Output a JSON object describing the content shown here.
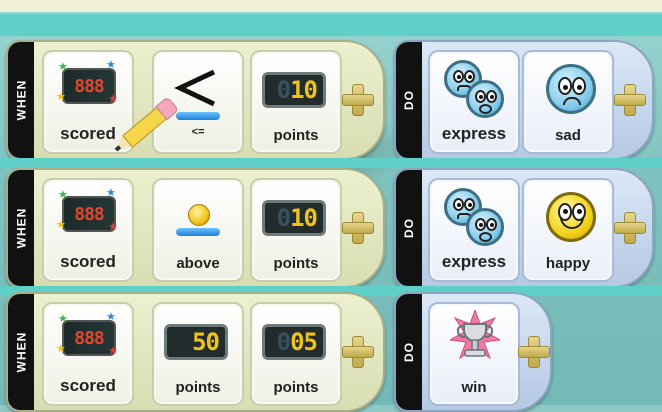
{
  "rules": [
    {
      "when_tab": "WHEN",
      "do_tab": "DO",
      "when_tiles": [
        {
          "kind": "score",
          "label": "scored",
          "digits": "888"
        },
        {
          "kind": "comparator",
          "symbol": "≤",
          "label": "<="
        },
        {
          "kind": "number",
          "label": "points",
          "dim": "0",
          "value": "10"
        }
      ],
      "do_tiles": [
        {
          "kind": "express",
          "label": "express"
        },
        {
          "kind": "face",
          "mood": "sad",
          "label": "sad"
        }
      ]
    },
    {
      "when_tab": "WHEN",
      "do_tab": "DO",
      "when_tiles": [
        {
          "kind": "score",
          "label": "scored",
          "digits": "888"
        },
        {
          "kind": "above",
          "label": "above"
        },
        {
          "kind": "number",
          "label": "points",
          "dim": "0",
          "value": "10"
        }
      ],
      "do_tiles": [
        {
          "kind": "express",
          "label": "express"
        },
        {
          "kind": "face",
          "mood": "happy",
          "label": "happy"
        }
      ]
    },
    {
      "when_tab": "WHEN",
      "do_tab": "DO",
      "when_tiles": [
        {
          "kind": "score",
          "label": "scored",
          "digits": "888"
        },
        {
          "kind": "number",
          "label": "points",
          "dim": "",
          "value": "50"
        },
        {
          "kind": "number",
          "label": "points",
          "dim": "0",
          "value": "05"
        }
      ],
      "do_tiles": [
        {
          "kind": "trophy",
          "label": "win"
        }
      ]
    }
  ],
  "colors": {
    "score_digits": "#e0482d",
    "number_digits": "#f0c21c",
    "tile_plus": "#d8c66c"
  }
}
